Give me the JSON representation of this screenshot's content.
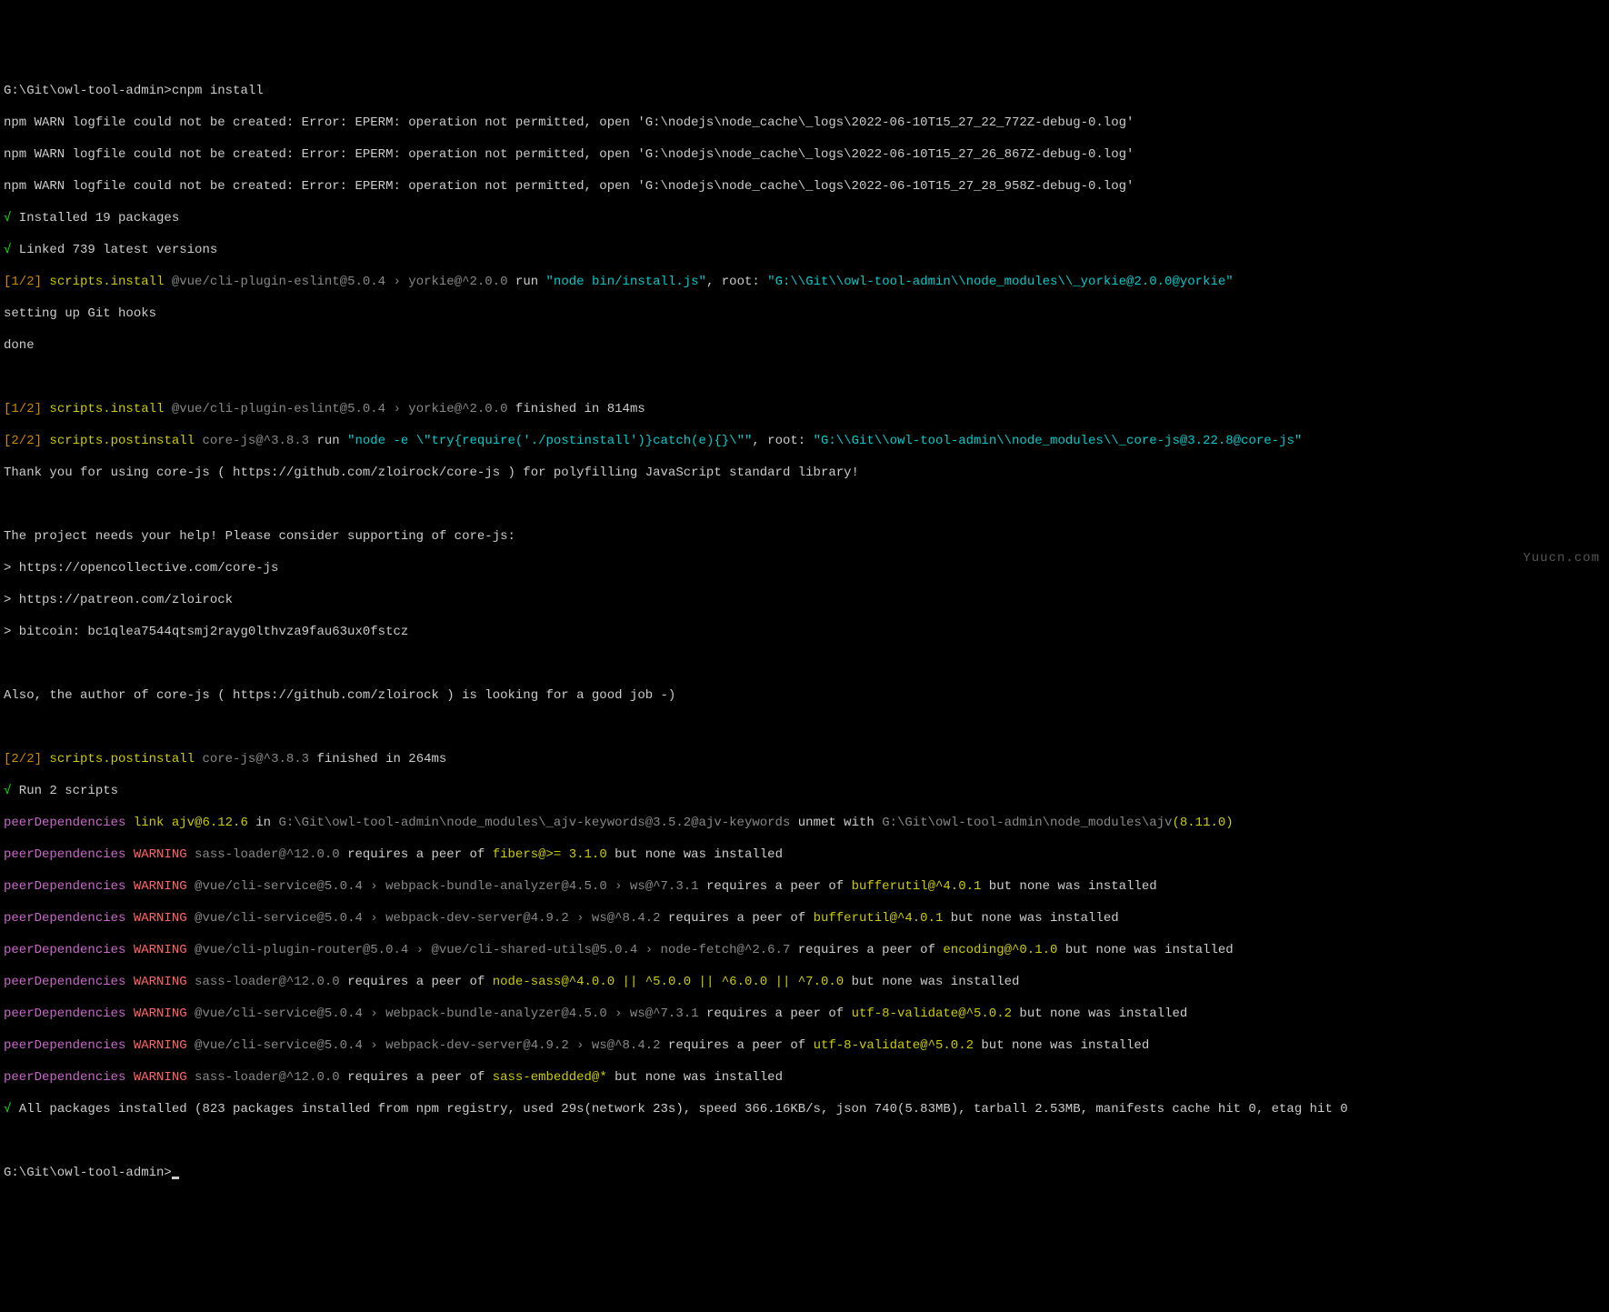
{
  "prompt1": {
    "path": "G:\\Git\\owl-tool-admin>",
    "cmd": "cnpm install"
  },
  "warn1": "npm WARN logfile could not be created: Error: EPERM: operation not permitted, open 'G:\\nodejs\\node_cache\\_logs\\2022-06-10T15_27_22_772Z-debug-0.log'",
  "warn2": "npm WARN logfile could not be created: Error: EPERM: operation not permitted, open 'G:\\nodejs\\node_cache\\_logs\\2022-06-10T15_27_26_867Z-debug-0.log'",
  "warn3": "npm WARN logfile could not be created: Error: EPERM: operation not permitted, open 'G:\\nodejs\\node_cache\\_logs\\2022-06-10T15_27_28_958Z-debug-0.log'",
  "check": "√",
  "inst19": " Installed 19 packages",
  "link739": " Linked 739 latest versions",
  "step1a": "[1/2]",
  "scripts_install": " scripts.install ",
  "pkg1": "@vue/cli-plugin-eslint@5.0.4 › yorkie@^2.0.0",
  "run": " run ",
  "run1cmd": "\"node bin/install.js\"",
  "root": ", root: ",
  "root1": "\"G:\\\\Git\\\\owl-tool-admin\\\\node_modules\\\\_yorkie@2.0.0@yorkie\"",
  "setting": "setting up Git hooks",
  "done": "done",
  "step1b": "[1/2]",
  "fin1": " finished in 814ms",
  "step2a": "[2/2]",
  "scripts_postinstall": " scripts.postinstall ",
  "pkg2": "core-js@^3.8.3",
  "run2cmd": "\"node -e \\\"try{require('./postinstall')}catch(e){}\\\"\"",
  "root2": "\"G:\\\\Git\\\\owl-tool-admin\\\\node_modules\\\\_core-js@3.22.8@core-js\"",
  "thanks": "Thank you for using core-js ( https://github.com/zloirock/core-js ) for polyfilling JavaScript standard library!",
  "help": "The project needs your help! Please consider supporting of core-js:",
  "s1": "> https://opencollective.com/core-js",
  "s2": "> https://patreon.com/zloirock",
  "s3": "> bitcoin: bc1qlea7544qtsmj2rayg0lthvza9fau63ux0fstcz",
  "author": "Also, the author of core-js ( https://github.com/zloirock ) is looking for a good job -)",
  "step2b": "[2/2]",
  "fin2": " finished in 264ms",
  "run2s": " Run 2 scripts",
  "pd": "peerDependencies",
  "link": " link ",
  "warn": " WARNING ",
  "ajv": "ajv@6.12.6",
  "in": " in ",
  "ajvpath": "G:\\Git\\owl-tool-admin\\node_modules\\_ajv-keywords@3.5.2@ajv-keywords",
  "unmet": " unmet with ",
  "ajvmod": "G:\\Git\\owl-tool-admin\\node_modules\\ajv",
  "ajvver": "(8.11.0)",
  "w1a": "sass-loader@^12.0.0",
  "w1b": " requires a peer of ",
  "w1c": "fibers@>= 3.1.0",
  "w1d": " but none was installed",
  "w2a": "@vue/cli-service@5.0.4 › webpack-bundle-analyzer@4.5.0 › ws@^7.3.1",
  "w2c": "bufferutil@^4.0.1",
  "w3a": "@vue/cli-service@5.0.4 › webpack-dev-server@4.9.2 › ws@^8.4.2",
  "w3c": "bufferutil@^4.0.1",
  "w4a": "@vue/cli-plugin-router@5.0.4 › @vue/cli-shared-utils@5.0.4 › node-fetch@^2.6.7",
  "w4c": "encoding@^0.1.0",
  "w5a": "sass-loader@^12.0.0",
  "w5c": "node-sass@^4.0.0 || ^5.0.0 || ^6.0.0 || ^7.0.0",
  "w6a": "@vue/cli-service@5.0.4 › webpack-bundle-analyzer@4.5.0 › ws@^7.3.1",
  "w6c": "utf-8-validate@^5.0.2",
  "w7a": "@vue/cli-service@5.0.4 › webpack-dev-server@4.9.2 › ws@^8.4.2",
  "w7c": "utf-8-validate@^5.0.2",
  "w8a": "sass-loader@^12.0.0",
  "w8c": "sass-embedded@*",
  "allpkg": " All packages installed (823 packages installed from npm registry, used 29s(network 23s), speed 366.16KB/s, json 740(5.83MB), tarball 2.53MB, manifests cache hit 0, etag hit 0",
  "prompt2": "G:\\Git\\owl-tool-admin>",
  "watermark": "Yuucn.com"
}
